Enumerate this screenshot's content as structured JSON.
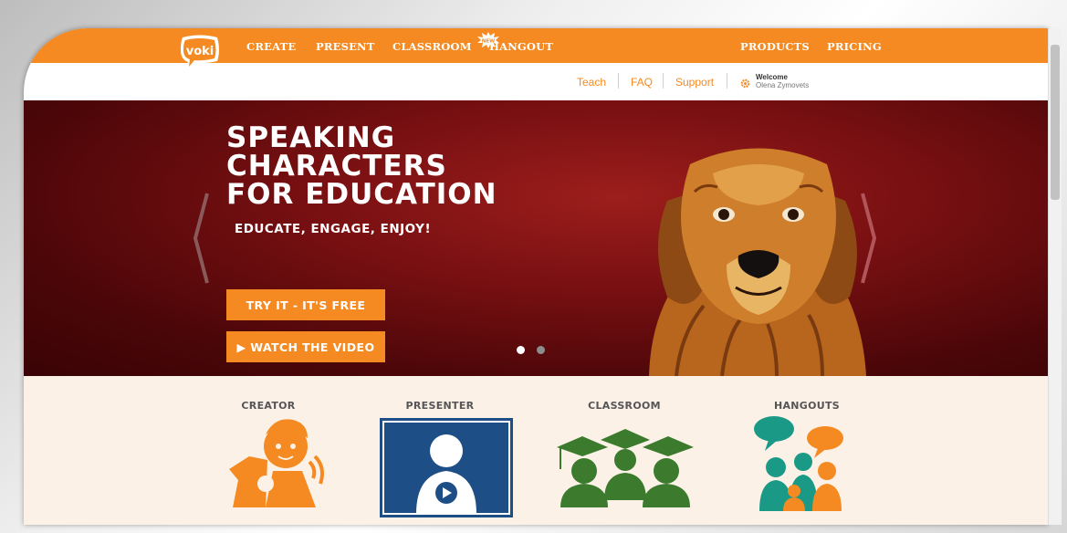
{
  "nav": {
    "logo_text": "voki",
    "left_items": [
      "CREATE",
      "PRESENT",
      "CLASSROOM",
      "HANGOUT"
    ],
    "badge": "NEW",
    "right_items": [
      "PRODUCTS",
      "PRICING"
    ]
  },
  "subnav": {
    "links": [
      "Teach",
      "FAQ",
      "Support"
    ],
    "welcome_label": "Welcome",
    "user_name": "Olena Zymovets"
  },
  "hero": {
    "headline_lines": [
      "SPEAKING",
      "CHARACTERS",
      "FOR EDUCATION"
    ],
    "tagline": "EDUCATE, ENGAGE, ENJOY!",
    "try_button": "TRY IT - IT'S FREE",
    "video_button": "▶ WATCH THE VIDEO",
    "slides": 2,
    "active_slide": 1
  },
  "products": [
    {
      "label": "CREATOR",
      "icon": "creator-character-icon"
    },
    {
      "label": "PRESENTER",
      "icon": "presenter-video-icon"
    },
    {
      "label": "CLASSROOM",
      "icon": "graduation-caps-icon"
    },
    {
      "label": "HANGOUTS",
      "icon": "group-chat-icon"
    }
  ],
  "colors": {
    "brand": "#f48a21",
    "hero_dark": "#4a0608",
    "hero_red": "#9c1e1c",
    "presenter_blue": "#1d4f86",
    "classroom_green": "#3c7a2e",
    "hangouts_teal": "#1a9a86"
  }
}
